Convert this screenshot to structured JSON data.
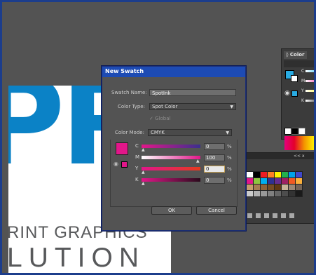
{
  "artboard": {
    "logo_letters": "PR",
    "line1": "RINT GRAPHICS",
    "line2": "LUTION",
    "brand_color": "#0b82c6"
  },
  "color_panel": {
    "tab_label": "Color",
    "channels": [
      "C",
      "M",
      "Y",
      "K"
    ],
    "fill_color": "#29abe2"
  },
  "swatches_panel": {
    "header_icons": [
      "<<",
      "x"
    ],
    "grid_colors": [
      "#ffffff",
      "#000000",
      "#ed1c24",
      "#ff7f27",
      "#fff200",
      "#22b14c",
      "#00a2e8",
      "#3f48cc",
      "#e2168a",
      "#8dc63f",
      "#00aeef",
      "#2e3192",
      "#662d91",
      "#9e1f63",
      "#f15a24",
      "#fbb03b",
      "#c69c6d",
      "#a67c52",
      "#8c6239",
      "#754c24",
      "#603813",
      "#c7b299",
      "#998675",
      "#736357",
      "#cccccc",
      "#b3b3b3",
      "#999999",
      "#808080",
      "#666666",
      "#4d4d4d",
      "#333333",
      "#1a1a1a"
    ],
    "footer_icons": [
      "swatch-library-icon",
      "show-kinds-icon",
      "swatch-options-icon",
      "new-color-group-icon",
      "new-swatch-icon",
      "delete-swatch-icon"
    ]
  },
  "dialog": {
    "title": "New Swatch",
    "swatch_name_label": "Swatch Name:",
    "swatch_name_value": "SpotInk",
    "color_type_label": "Color Type:",
    "color_type_value": "Spot Color",
    "global_label": "Global",
    "color_mode_label": "Color Mode:",
    "color_mode_value": "CMYK",
    "preview_color": "#e2168a",
    "channels": [
      {
        "letter": "C",
        "value": "0",
        "unit": "%",
        "level": 0
      },
      {
        "letter": "M",
        "value": "100",
        "unit": "%",
        "level": 1.0
      },
      {
        "letter": "Y",
        "value": "0",
        "unit": "%",
        "level": 0
      },
      {
        "letter": "K",
        "value": "0",
        "unit": "%",
        "level": 0
      }
    ],
    "ok_label": "OK",
    "cancel_label": "Cancel"
  }
}
